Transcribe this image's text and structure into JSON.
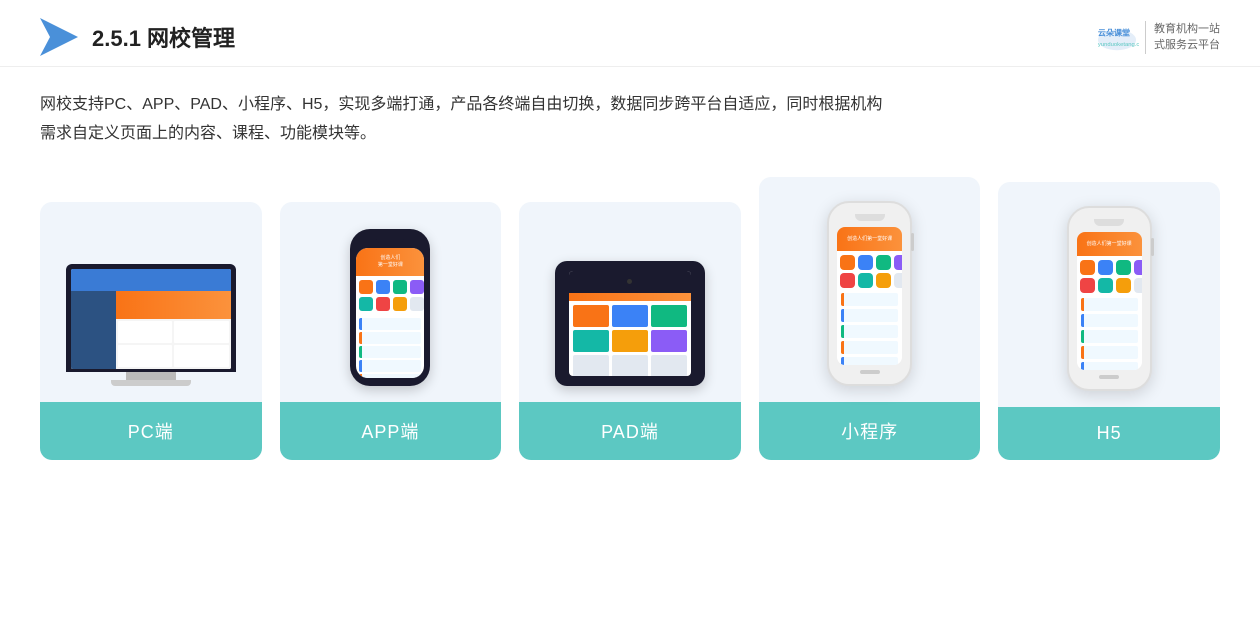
{
  "header": {
    "title_prefix": "2.5.1 ",
    "title_bold": "网校管理",
    "brand_name_line1": "教育机构一站",
    "brand_name_line2": "式服务云平台",
    "brand_domain": "yunduoketang.com"
  },
  "description": {
    "line1": "网校支持PC、APP、PAD、小程序、H5，实现多端打通，产品各终端自由切换，数据同步跨平台自适应，同时根据机构",
    "line2": "需求自定义页面上的内容、课程、功能模块等。"
  },
  "cards": [
    {
      "id": "pc",
      "label": "PC端"
    },
    {
      "id": "app",
      "label": "APP端"
    },
    {
      "id": "pad",
      "label": "PAD端"
    },
    {
      "id": "miniprogram",
      "label": "小程序"
    },
    {
      "id": "h5",
      "label": "H5"
    }
  ],
  "colors": {
    "card_bg": "#eef4fb",
    "card_label_bg": "#5cc8c2",
    "card_label_text": "#ffffff"
  }
}
